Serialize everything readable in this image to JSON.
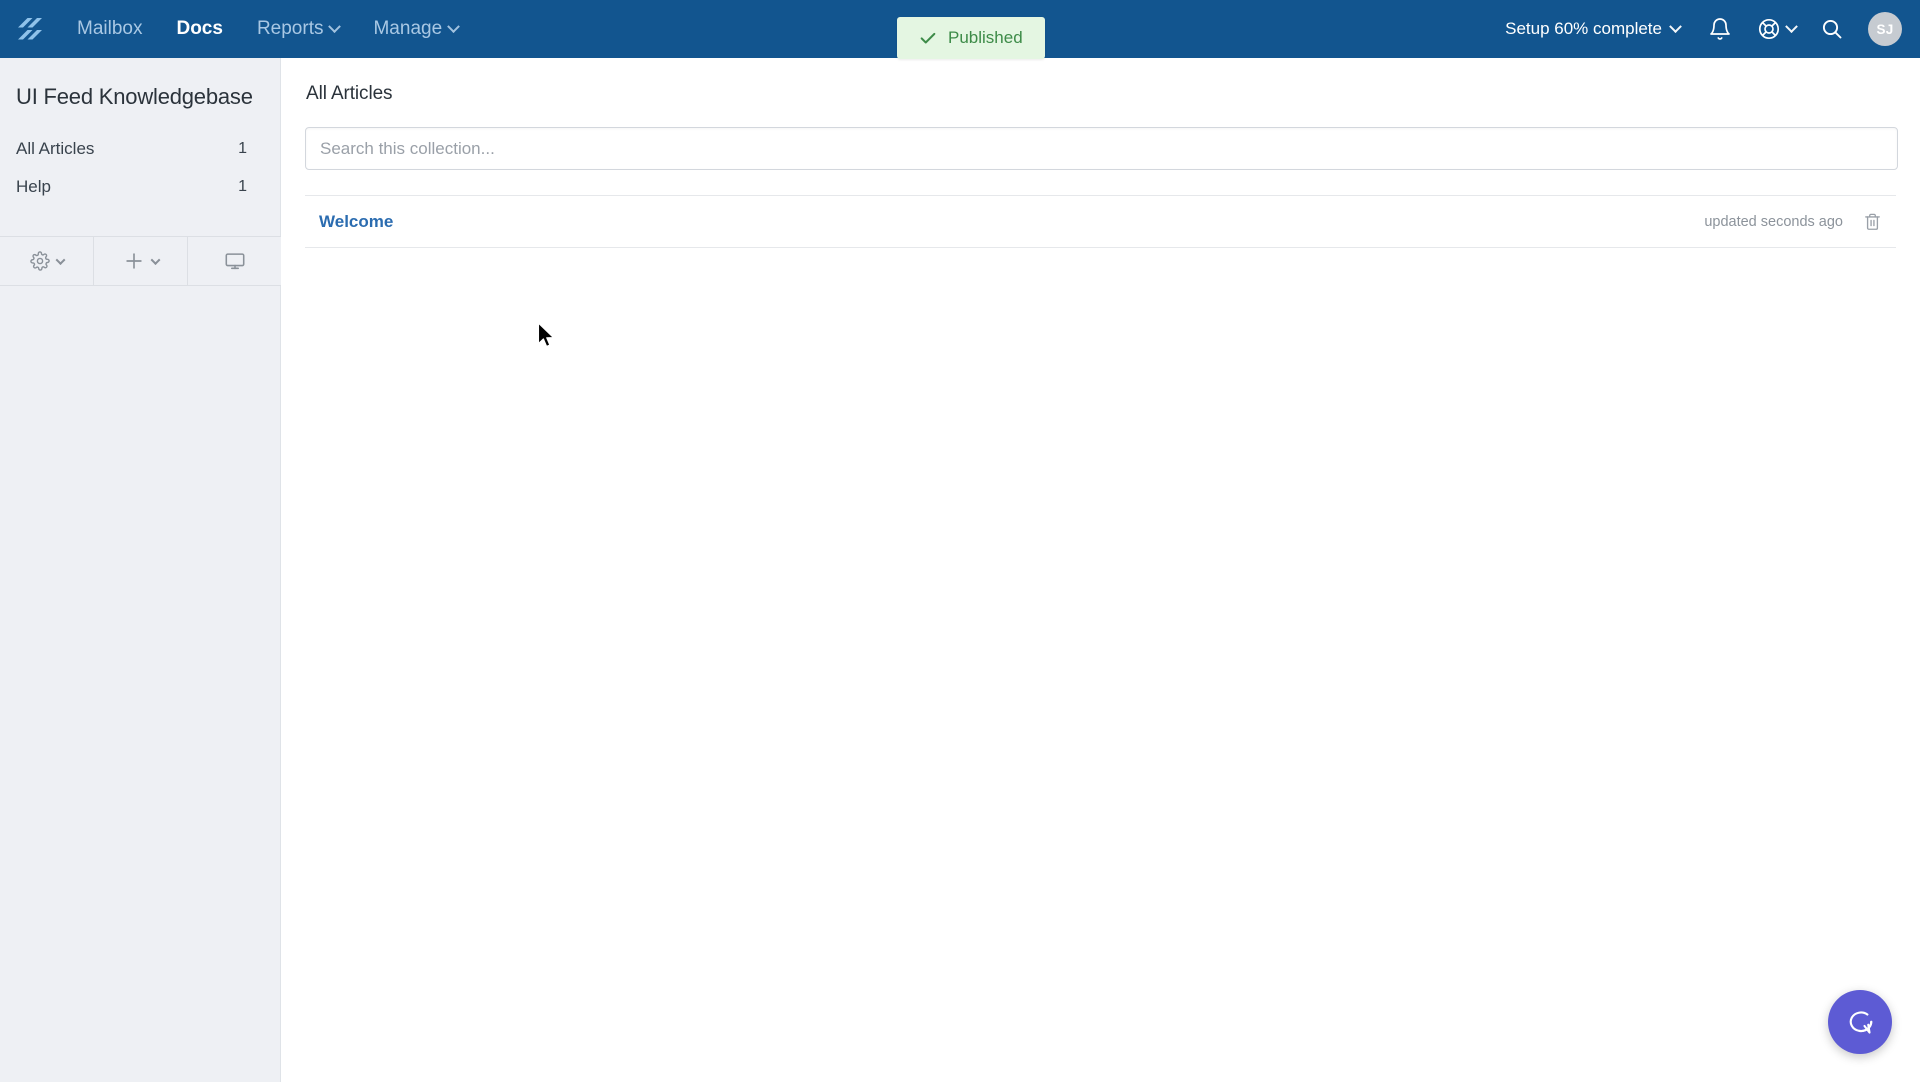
{
  "topnav": {
    "logo_icon": "helpscout-logo-icon",
    "links": [
      {
        "label": "Mailbox",
        "active": false,
        "has_caret": false
      },
      {
        "label": "Docs",
        "active": true,
        "has_caret": false
      },
      {
        "label": "Reports",
        "active": false,
        "has_caret": true
      },
      {
        "label": "Manage",
        "active": false,
        "has_caret": true
      }
    ],
    "setup_label": "Setup 60% complete",
    "notifications_icon": "bell-icon",
    "help_icon": "lifebuoy-icon",
    "search_icon": "search-icon",
    "avatar_initials": "SJ",
    "background_color": "#12558f"
  },
  "toast": {
    "label": "Published",
    "icon": "check-icon",
    "background_color": "#e4f6e2",
    "text_color": "#3d8b48"
  },
  "sidebar": {
    "title": "UI Feed Knowledgebase",
    "items": [
      {
        "label": "All Articles",
        "count": "1"
      },
      {
        "label": "Help",
        "count": "1"
      }
    ],
    "toolbar": [
      {
        "name": "settings",
        "icon": "gear-icon",
        "has_caret": true
      },
      {
        "name": "create",
        "icon": "plus-icon",
        "has_caret": true
      },
      {
        "name": "preview",
        "icon": "monitor-icon",
        "has_caret": false
      }
    ],
    "background_color": "#eef0f4"
  },
  "main": {
    "page_title": "All Articles",
    "search": {
      "placeholder": "Search this collection...",
      "value": ""
    },
    "articles": [
      {
        "title": "Welcome",
        "meta": "updated seconds ago",
        "delete_icon": "trash-icon"
      }
    ]
  },
  "beacon": {
    "icon": "chat-bubble-icon",
    "color": "#5d5bd4"
  }
}
